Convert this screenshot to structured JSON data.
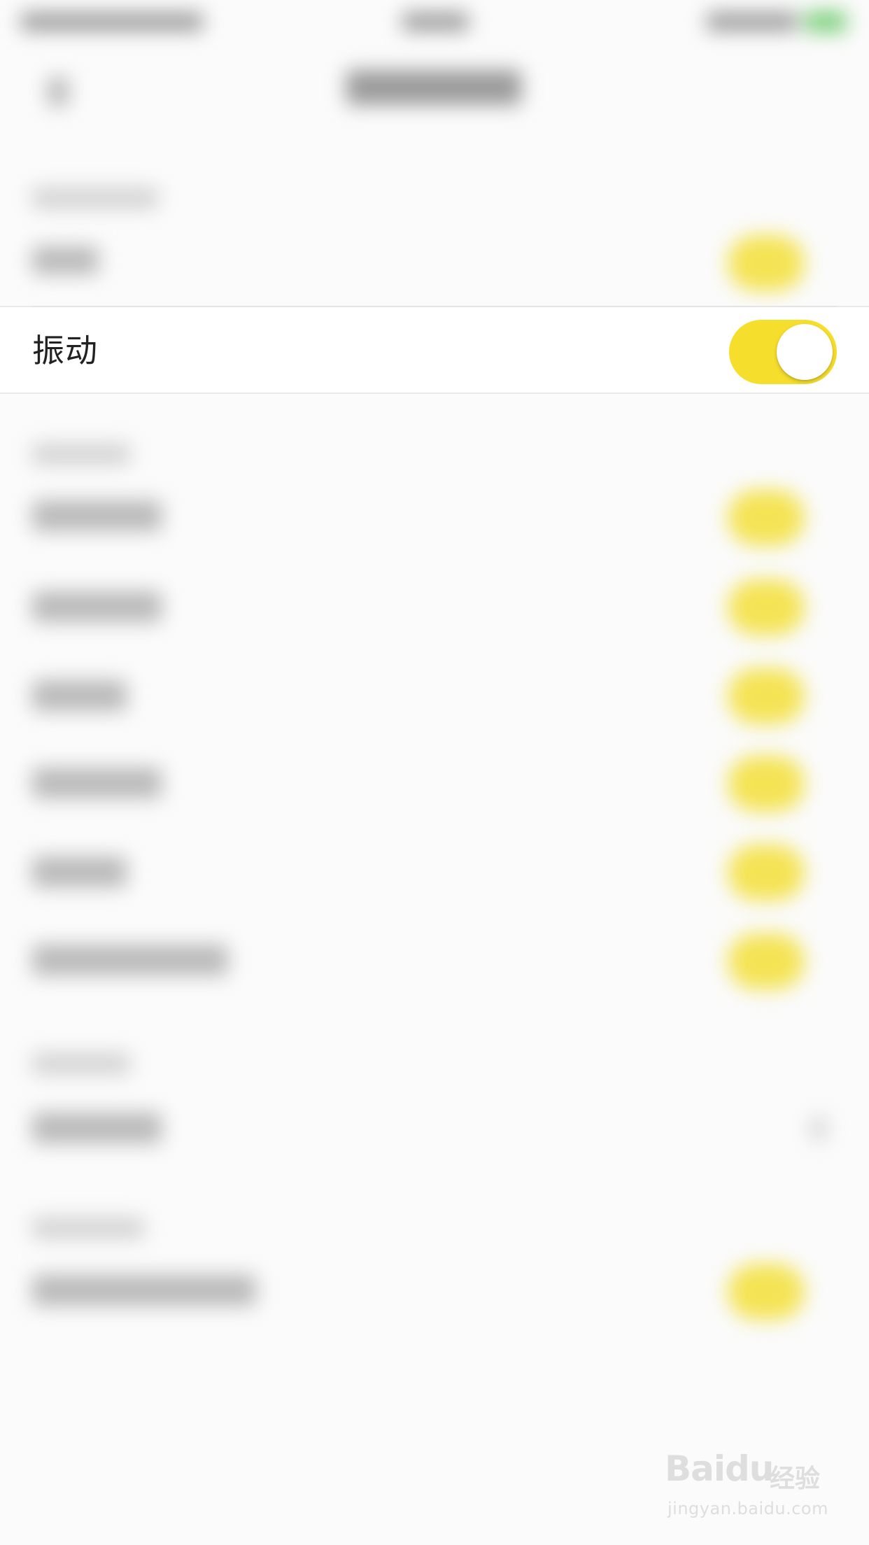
{
  "settings": {
    "vibrate_label": "振动",
    "vibrate_enabled": true,
    "toggle_on_color": "#f6de2c"
  },
  "watermark": {
    "brand": "Baidu",
    "brand_cn": "经验",
    "url": "jingyan.baidu.com"
  }
}
